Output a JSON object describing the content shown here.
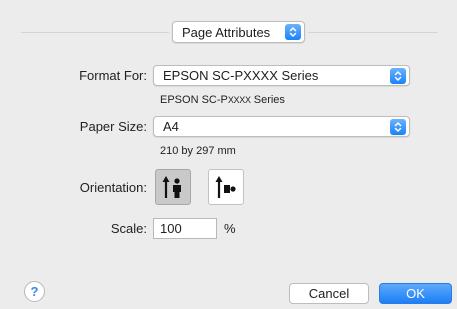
{
  "header": {
    "popup_value": "Page Attributes"
  },
  "format_for": {
    "label": "Format For:",
    "value": "EPSON SC-PXXXX Series",
    "detail_prefix": "EPSON SC-P",
    "detail_model": "XXXX",
    "detail_suffix": "Series"
  },
  "paper_size": {
    "label": "Paper Size:",
    "value": "A4",
    "dimensions": "210 by 297 mm"
  },
  "orientation": {
    "label": "Orientation:",
    "selected": "portrait",
    "options": [
      "portrait-orientation-icon",
      "landscape-orientation-icon"
    ]
  },
  "scale": {
    "label": "Scale:",
    "value": "100",
    "unit": "%"
  },
  "footer": {
    "help": "?",
    "cancel_label": "Cancel",
    "ok_label": "OK"
  },
  "colors": {
    "accent": "#1a82fb",
    "background": "#ececec"
  }
}
